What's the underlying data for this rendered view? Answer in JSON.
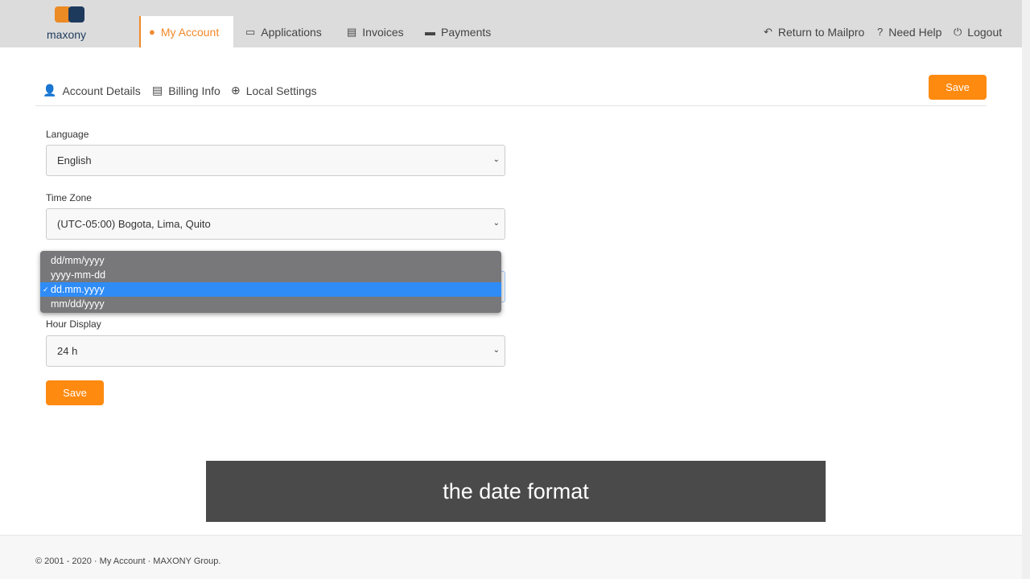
{
  "brand": {
    "logo_text": "maxony",
    "accent": "#ff8a10"
  },
  "nav": {
    "tabs": [
      {
        "label": "My Account",
        "icon": "user-circle-icon"
      },
      {
        "label": "Applications",
        "icon": "monitor-icon"
      },
      {
        "label": "Invoices",
        "icon": "document-icon"
      },
      {
        "label": "Payments",
        "icon": "credit-card-icon"
      }
    ],
    "right": [
      {
        "label": "Return to Mailpro",
        "icon": "reply-icon"
      },
      {
        "label": "Need Help",
        "icon": "question-icon"
      },
      {
        "label": "Logout",
        "icon": "power-icon"
      }
    ]
  },
  "subnav": [
    {
      "label": "Account Details"
    },
    {
      "label": "Billing Info"
    },
    {
      "label": "Local Settings"
    }
  ],
  "top_save": "Save",
  "form": {
    "language": {
      "label": "Language",
      "value": "English"
    },
    "timezone": {
      "label": "Time Zone",
      "value": "(UTC-05:00) Bogota, Lima, Quito"
    },
    "date_format": {
      "options": [
        "dd/mm/yyyy",
        "yyyy-mm-dd",
        "dd.mm.yyyy",
        "mm/dd/yyyy"
      ],
      "selected": "dd.mm.yyyy"
    },
    "hour": {
      "label": "Hour Display",
      "value": "24 h"
    },
    "save": "Save"
  },
  "caption": "the date format",
  "footer": "© 2001 - 2020 · My Account · MAXONY Group."
}
